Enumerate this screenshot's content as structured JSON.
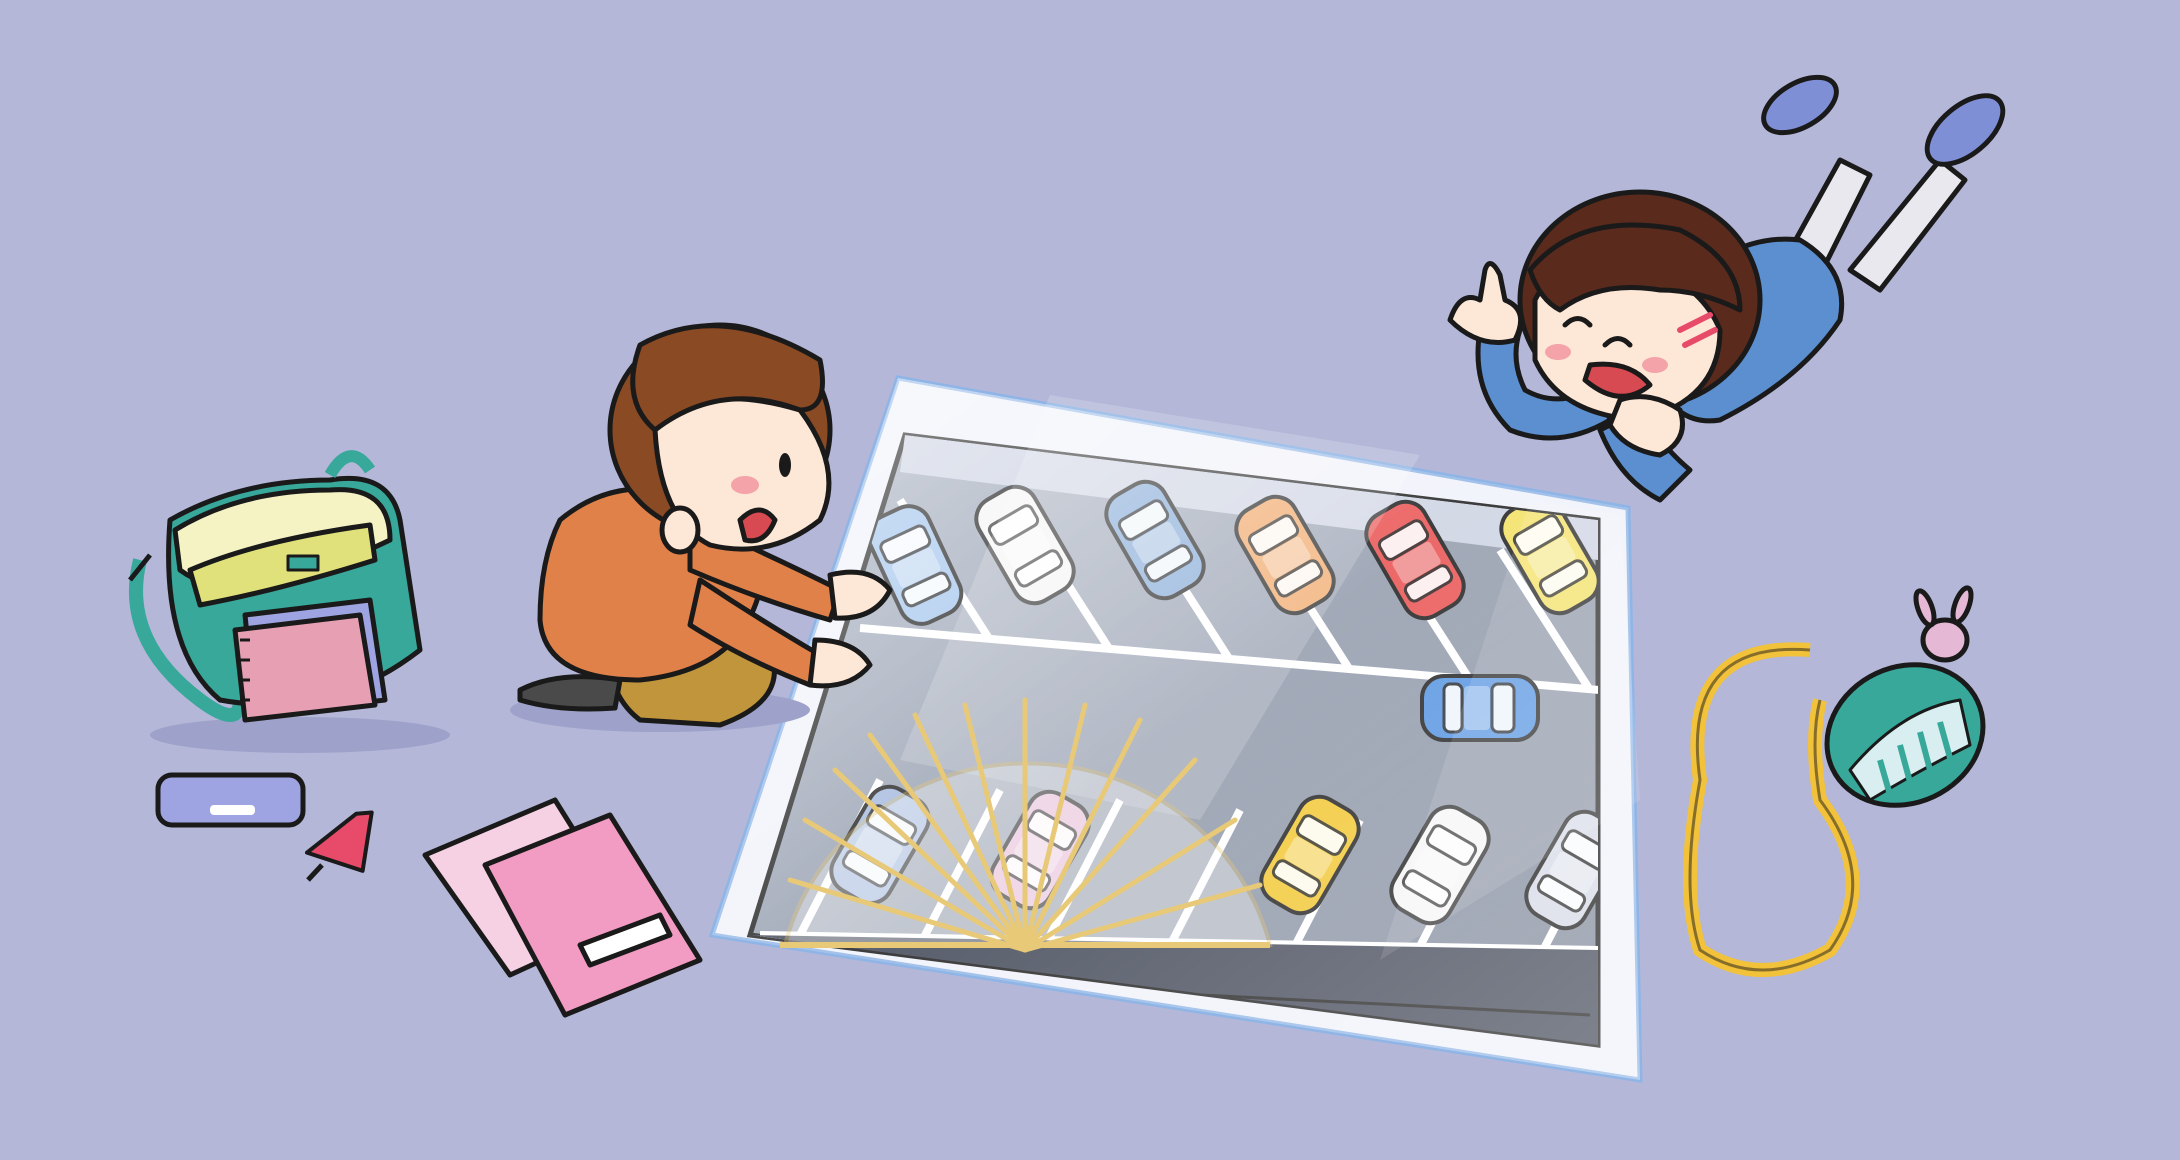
{
  "scene": {
    "background_color": "#b4b7d8",
    "outline_color": "#1a1a1a",
    "skin_color": "#fde7d6",
    "characters": [
      {
        "pose": "kneeling",
        "hair_color": "#8a4a24",
        "shirt_color": "#e0814a",
        "pants_color": "#c0953c"
      },
      {
        "pose": "lying-prone",
        "hair_color": "#5a2a1c",
        "shirt_color": "#5b8fd0",
        "shoe_color": "#7f8fd6"
      }
    ],
    "parking_lot": {
      "frame_color": "#eef0fa",
      "floor_color": "#8e98ab",
      "line_color": "#ffffff",
      "ruler_color": "#e8c978",
      "cars": [
        {
          "color": "#9fc2ec"
        },
        {
          "color": "#f4f4f4"
        },
        {
          "color": "#7fa6d6"
        },
        {
          "color": "#f0a361"
        },
        {
          "color": "#e94e4e"
        },
        {
          "color": "#f3df5e"
        },
        {
          "color": "#4e8fe0"
        },
        {
          "color": "#f1c529"
        },
        {
          "color": "#f4f4f4"
        },
        {
          "color": "#d5d9e6"
        },
        {
          "color": "#9fb5dc"
        },
        {
          "color": "#e5b9d5"
        }
      ]
    },
    "objects": [
      {
        "name": "backpack",
        "colors": [
          "#37a89a",
          "#f5f2c4",
          "#e7a0b3"
        ]
      },
      {
        "name": "notebooks",
        "colors": [
          "#f29cc3",
          "#f6d0e3"
        ]
      },
      {
        "name": "eraser",
        "colors": [
          "#9ea4e2"
        ]
      },
      {
        "name": "pencil",
        "colors": [
          "#e84b6a"
        ]
      },
      {
        "name": "crossbody-bag",
        "colors": [
          "#37a89a",
          "#f2c23a"
        ]
      }
    ]
  }
}
